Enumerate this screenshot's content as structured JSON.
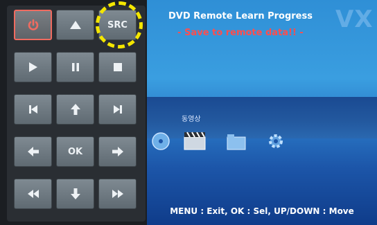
{
  "remote": {
    "buttons": [
      {
        "id": "power",
        "label": ""
      },
      {
        "id": "up",
        "label": ""
      },
      {
        "id": "src",
        "label": "SRC"
      },
      {
        "id": "play",
        "label": ""
      },
      {
        "id": "pause",
        "label": ""
      },
      {
        "id": "stop",
        "label": ""
      },
      {
        "id": "prev",
        "label": ""
      },
      {
        "id": "up2",
        "label": ""
      },
      {
        "id": "next",
        "label": ""
      },
      {
        "id": "left",
        "label": ""
      },
      {
        "id": "ok",
        "label": "OK"
      },
      {
        "id": "right",
        "label": ""
      },
      {
        "id": "rew",
        "label": ""
      },
      {
        "id": "down",
        "label": ""
      },
      {
        "id": "ff",
        "label": ""
      }
    ]
  },
  "screen": {
    "title": "DVD Remote Learn Progress",
    "subtitle": "- Save to remote data!! -",
    "watermark": "VX",
    "menu_label": "동영상",
    "hint": "MENU : Exit, OK : Sel, UP/DOWN : Move"
  },
  "colors": {
    "accent_red": "#ff4e4e",
    "annotation": "#f4e600",
    "power_border": "#f06b60"
  }
}
